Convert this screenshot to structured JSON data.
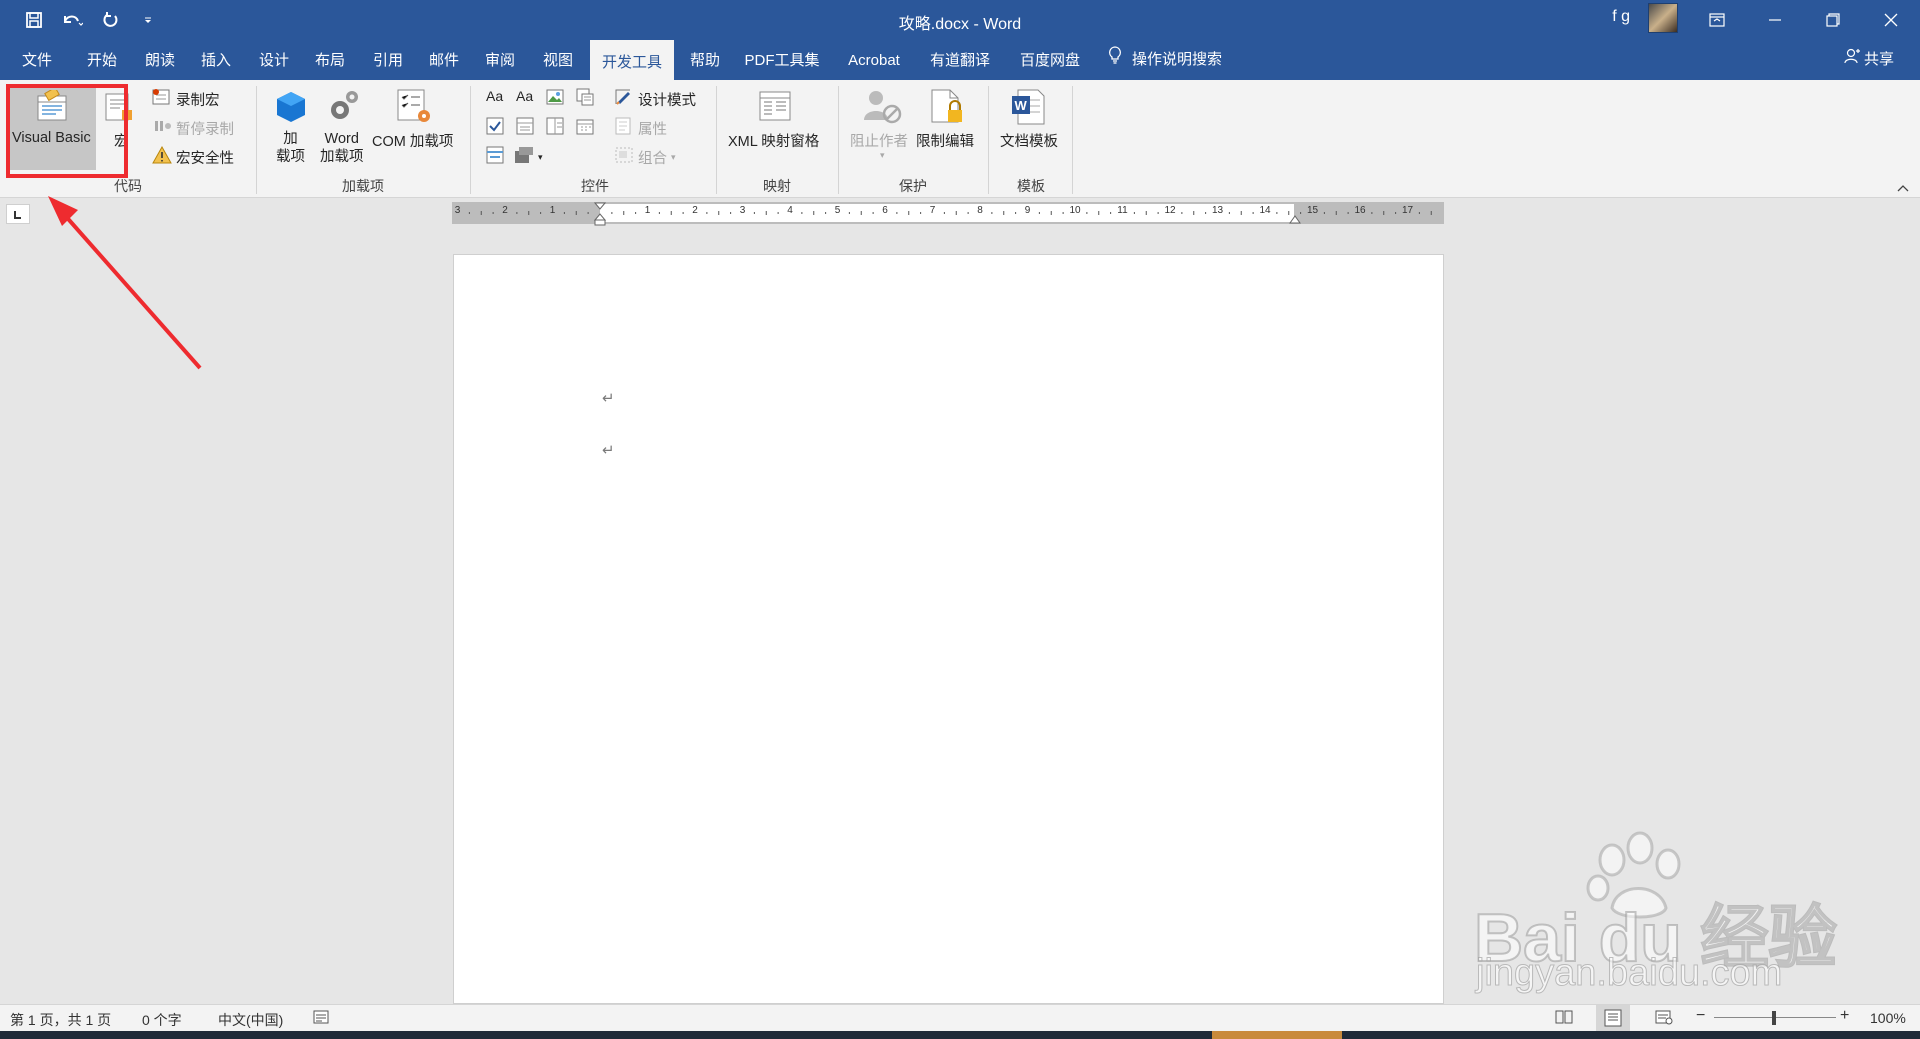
{
  "titlebar": {
    "doc_title": "攻略.docx  -  Word",
    "user": "f g",
    "qat": [
      "save-icon",
      "undo-icon",
      "redo-icon",
      "customize-icon"
    ]
  },
  "tabs": [
    {
      "label": "文件"
    },
    {
      "label": "开始"
    },
    {
      "label": "朗读"
    },
    {
      "label": "插入"
    },
    {
      "label": "设计"
    },
    {
      "label": "布局"
    },
    {
      "label": "引用"
    },
    {
      "label": "邮件"
    },
    {
      "label": "审阅"
    },
    {
      "label": "视图"
    },
    {
      "label": "开发工具",
      "active": true
    },
    {
      "label": "帮助"
    },
    {
      "label": "PDF工具集"
    },
    {
      "label": "Acrobat"
    },
    {
      "label": "有道翻译"
    },
    {
      "label": "百度网盘"
    }
  ],
  "tell_me": "操作说明搜索",
  "share": "共享",
  "ribbon": {
    "code": {
      "label": "代码",
      "visual_basic": "Visual Basic",
      "macros": "宏",
      "record_macro": "录制宏",
      "pause_recording": "暂停录制",
      "macro_security": "宏安全性"
    },
    "addins": {
      "label": "加载项",
      "addins_btn": "加\n载项",
      "addins_line1": "加",
      "addins_line2": "载项",
      "word_addins_line1": "Word",
      "word_addins_line2": "加载项",
      "com_addins": "COM 加载项"
    },
    "controls": {
      "label": "控件",
      "design_mode": "设计模式",
      "properties": "属性",
      "group": "组合"
    },
    "mapping": {
      "label": "映射",
      "xml_pane": "XML 映射窗格"
    },
    "protect": {
      "label": "保护",
      "block_authors": "阻止作者",
      "restrict_editing": "限制编辑"
    },
    "templates": {
      "label": "模板",
      "doc_template": "文档模板"
    }
  },
  "ruler": {
    "left_nums": [
      "3",
      "2",
      "1"
    ],
    "nums": [
      "1",
      "2",
      "3",
      "4",
      "5",
      "6",
      "7",
      "8",
      "9",
      "10",
      "11",
      "12",
      "13",
      "14"
    ],
    "right_nums": [
      "15",
      "16",
      "17"
    ]
  },
  "document": {
    "para_mark": "↵"
  },
  "status": {
    "page": "第 1 页，共 1 页",
    "words": "0 个字",
    "language": "中文(中国)",
    "zoom": "100%",
    "zoom_minus": "−",
    "zoom_plus": "+"
  },
  "watermark": {
    "brand": "Bai du 经验",
    "url": "jingyan.baidu.com"
  },
  "colors": {
    "title_bar": "#2b579a",
    "ribbon": "#f3f3f3",
    "highlight": "#ee2b2f"
  }
}
